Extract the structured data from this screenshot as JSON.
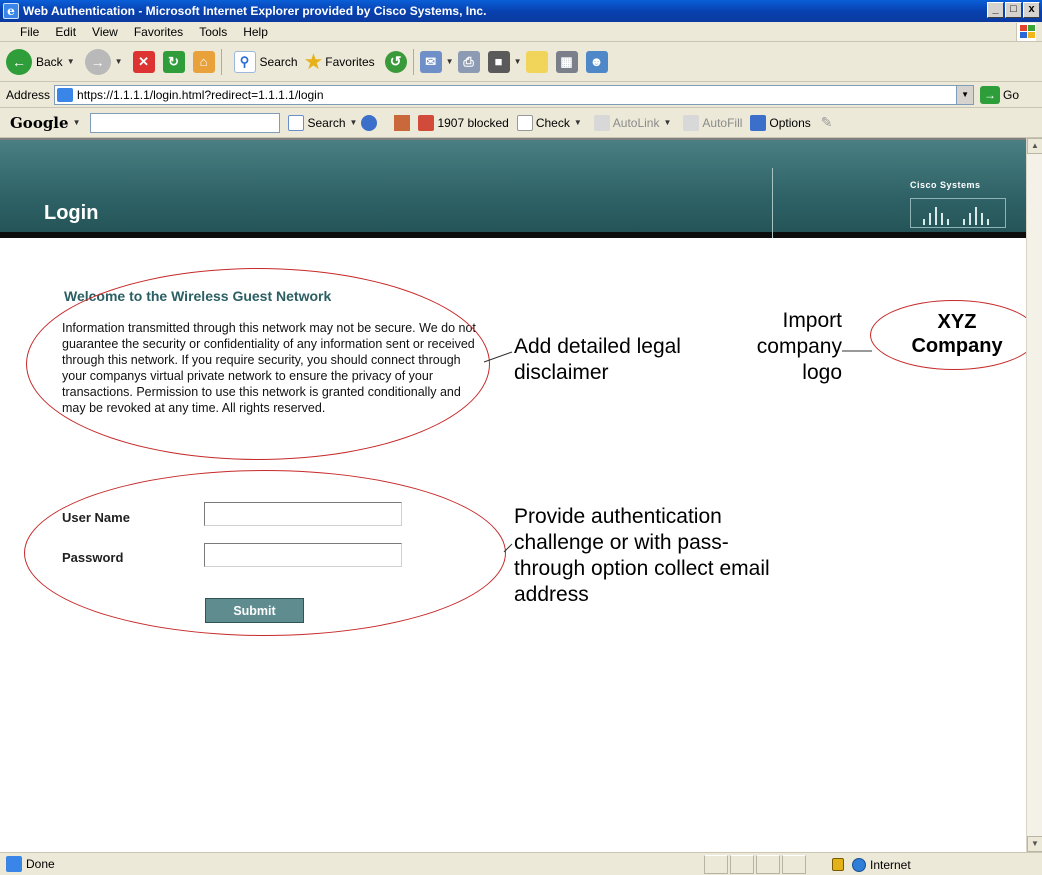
{
  "window": {
    "title": "Web Authentication - Microsoft Internet Explorer provided by Cisco Systems, Inc.",
    "min": "_",
    "max": "□",
    "close": "x"
  },
  "menu": [
    "File",
    "Edit",
    "View",
    "Favorites",
    "Tools",
    "Help"
  ],
  "toolbar": {
    "back": "Back",
    "search": "Search",
    "favorites": "Favorites"
  },
  "address": {
    "label": "Address",
    "url": "https://1.1.1.1/login.html?redirect=1.1.1.1/login",
    "go": "Go"
  },
  "google": {
    "logo": "Google",
    "search": "Search",
    "blocked": "1907 blocked",
    "check": "Check",
    "autolink": "AutoLink",
    "autofill": "AutoFill",
    "options": "Options"
  },
  "page": {
    "title": "Login",
    "brand": "Cisco Systems",
    "welcome": "Welcome to the Wireless Guest Network",
    "disclaimer": "Information transmitted through this network may not be secure. We do not guarantee the security or confidentiality of any information sent or received through this network. If you require security, you should connect through your companys virtual private network to ensure the privacy of your transactions. Permission to use this network is granted conditionally and may be revoked at any time. All rights reserved.",
    "username_label": "User Name",
    "password_label": "Password",
    "username_value": "",
    "password_value": "",
    "submit": "Submit"
  },
  "annotations": {
    "legal": "Add detailed legal disclaimer",
    "auth": "Provide authentication challenge or with pass-through option collect email address",
    "logo": "Import company logo",
    "company": "XYZ Company"
  },
  "status": {
    "text": "Done",
    "zone": "Internet"
  }
}
